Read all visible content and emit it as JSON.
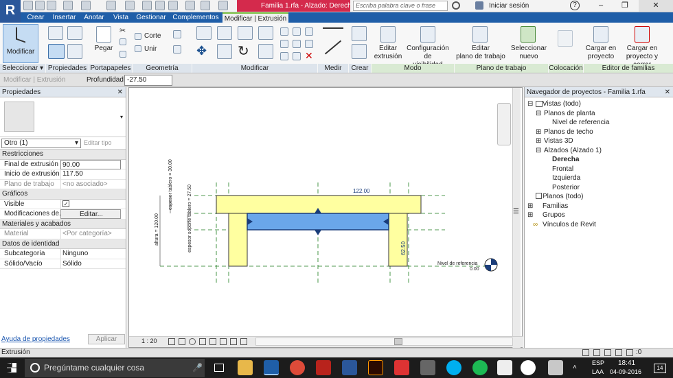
{
  "title": {
    "document": "Familia 1.rfa - Alzado: Derech...",
    "search_placeholder": "Escriba palabra clave o frase",
    "signin": "Iniciar sesión",
    "help": "?"
  },
  "tabs": [
    {
      "label": "Crear"
    },
    {
      "label": "Insertar"
    },
    {
      "label": "Anotar"
    },
    {
      "label": "Vista"
    },
    {
      "label": "Gestionar"
    },
    {
      "label": "Complementos"
    },
    {
      "label": "Modificar | Extrusión"
    }
  ],
  "ribbon": {
    "modificar": "Modificar",
    "pegar": "Pegar",
    "corte": "Corte",
    "unir": "Unir",
    "editar_extrusion": [
      "Editar",
      "extrusión"
    ],
    "config_visibilidad": [
      "Configuración de",
      "visibilidad"
    ],
    "editar_plano": [
      "Editar",
      "plano de trabajo"
    ],
    "seleccionar_nuevo": [
      "Seleccionar",
      "nuevo"
    ],
    "cargar_proyecto": [
      "Cargar en",
      "proyecto"
    ],
    "cargar_cerrar": [
      "Cargar en",
      "proyecto y cerrar"
    ],
    "panels": [
      "Seleccionar ▾",
      "Propiedades",
      "Portapapeles",
      "Geometría",
      "Modificar",
      "Medir",
      "Crear",
      "Modo",
      "Plano de trabajo",
      "Colocación",
      "Editor de familias"
    ]
  },
  "optionbar": {
    "context": "Modificar | Extrusión",
    "depth_label": "Profundidad",
    "depth_value": "-27.50"
  },
  "properties": {
    "title": "Propiedades",
    "type_selector": "Otro (1)",
    "edit_type": "Editar tipo",
    "sections": {
      "restricciones": "Restricciones",
      "graficos": "Gráficos",
      "materiales": "Materiales y acabados",
      "identidad": "Datos de identidad"
    },
    "rows": {
      "final_k": "Final de extrusión",
      "final_v": "90.00",
      "inicio_k": "Inicio de extrusión",
      "inicio_v": "117.50",
      "plano_k": "Plano de trabajo",
      "plano_v": "<no asociado>",
      "visible_k": "Visible",
      "modif_k": "Modificaciones de...",
      "modif_v": "Editar...",
      "material_k": "Material",
      "material_v": "<Por categoría>",
      "subcat_k": "Subcategoría",
      "subcat_v": "Ninguno",
      "solido_k": "Sólido/Vacío",
      "solido_v": "Sólido"
    },
    "help_link": "Ayuda de propiedades",
    "apply": "Aplicar"
  },
  "canvas": {
    "dim_top": "122.00",
    "dim_left1": "espesor tablero = 30.00",
    "dim_left2": "espesor soporte tablero = 27.50",
    "dim_left3": "altura = 120.00",
    "dim_right": "62.50",
    "level_name": "Nivel de referencia",
    "level_value": "0.00",
    "scale": "1 : 20",
    "colors": {
      "leg_fill": "#ffffa0",
      "beam_fill": "#6aa6ea"
    }
  },
  "browser": {
    "title": "Navegador de proyectos - Familia 1.rfa",
    "nodes": [
      "Vistas (todo)",
      "Planos de planta",
      "Nivel de referencia",
      "Planos de techo",
      "Vistas 3D",
      "Alzados (Alzado 1)",
      "Derecha",
      "Frontal",
      "Izquierda",
      "Posterior",
      "Planos (todo)",
      "Familias",
      "Grupos",
      "Vínculos de Revit"
    ]
  },
  "status": {
    "text": "Extrusión",
    "count": ":0"
  },
  "taskbar": {
    "search": "Pregúntame cualquier cosa",
    "lang1": "ESP",
    "lang2": "LAA",
    "time": "18:41",
    "date": "04-09-2016",
    "notif": "14"
  }
}
